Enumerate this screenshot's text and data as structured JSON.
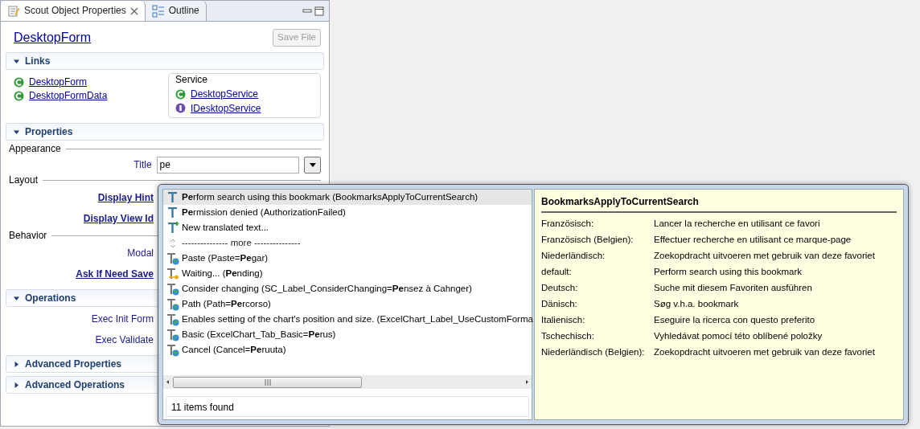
{
  "tabs": [
    {
      "label": "Scout Object Properties",
      "selected": true
    },
    {
      "label": "Outline",
      "selected": false
    }
  ],
  "form": {
    "title": "DesktopForm",
    "save_button": "Save File",
    "save_disabled": true
  },
  "sections": [
    {
      "kind": "links",
      "title": "Links",
      "expanded": true,
      "links": [
        {
          "name": "DesktopForm",
          "kind": "class"
        },
        {
          "name": "DesktopFormData",
          "kind": "class"
        }
      ],
      "service": {
        "title": "Service",
        "links": [
          {
            "name": "DesktopService",
            "kind": "class"
          },
          {
            "name": "IDesktopService",
            "kind": "interface"
          }
        ]
      }
    },
    {
      "kind": "properties",
      "title": "Properties",
      "expanded": true,
      "groups": [
        {
          "title": "Appearance",
          "rows": [
            {
              "label": "Title",
              "link": false,
              "value": "pe"
            }
          ]
        },
        {
          "title": "Layout",
          "rows": [
            {
              "label": "Display Hint",
              "link": true
            },
            {
              "label": "Display View Id",
              "link": true
            }
          ]
        },
        {
          "title": "Behavior",
          "rows": [
            {
              "label": "Modal",
              "link": false
            },
            {
              "label": "Ask If Need Save",
              "link": true
            }
          ]
        }
      ]
    },
    {
      "kind": "operations",
      "title": "Operations",
      "expanded": true,
      "rows": [
        {
          "label": "Exec Init Form",
          "link": false
        },
        {
          "label": "Exec Validate",
          "link": false
        }
      ]
    },
    {
      "title": "Advanced Properties",
      "expanded": false
    },
    {
      "title": "Advanced Operations",
      "expanded": false
    }
  ],
  "popup": {
    "items": [
      {
        "kind": "text",
        "text": "**Pe**rform search using this bookmark (BookmarksApplyToCurrentSearch)",
        "selected": true
      },
      {
        "kind": "text",
        "text": "**Pe**rmission denied (AuthorizationFailed)",
        "selected": false
      },
      {
        "kind": "new",
        "text": "New translated text...",
        "selected": false
      },
      {
        "kind": "more",
        "text": "--------------- more ---------------",
        "selected": false
      },
      {
        "kind": "nls",
        "text": "Paste (Paste=**Pe**gar)",
        "selected": false
      },
      {
        "kind": "pending",
        "text": "Waiting... (**Pe**nding)",
        "selected": false
      },
      {
        "kind": "nls",
        "text": "Consider changing (SC_Label_ConsiderChanging=**Pe**nsez à Cahnger)",
        "selected": false
      },
      {
        "kind": "nls",
        "text": "Path (Path=**Pe**rcorso)",
        "selected": false
      },
      {
        "kind": "nls",
        "text": "Enables setting of the chart's position and size. (ExcelChart_Label_UseCustomForma",
        "selected": false
      },
      {
        "kind": "nls",
        "text": "Basic (ExcelChart_Tab_Basic=**Pe**rus)",
        "selected": false
      },
      {
        "kind": "nls",
        "text": "Cancel (Cancel=**Pe**ruuta)",
        "selected": false
      }
    ],
    "status": "11 items found",
    "detail": {
      "title": "BookmarksApplyToCurrentSearch",
      "entries": [
        {
          "language": "Französisch:",
          "text": "Lancer la recherche en utilisant ce favori"
        },
        {
          "language": "Französisch (Belgien):",
          "text": "Effectuer recherche en utilisant ce marque-page"
        },
        {
          "language": "Niederländisch:",
          "text": "Zoekopdracht uitvoeren met gebruik van deze favoriet"
        },
        {
          "language": "default:",
          "text": "Perform search using this bookmark"
        },
        {
          "language": "Deutsch:",
          "text": "Suche mit diesem Favoriten ausführen"
        },
        {
          "language": "Dänisch:",
          "text": "Søg v.h.a. bookmark"
        },
        {
          "language": "Italienisch:",
          "text": "Eseguire la ricerca con questo preferito"
        },
        {
          "language": "Tschechisch:",
          "text": "Vyhledávat pomocí této oblíbené položky"
        },
        {
          "language": "Niederländisch (Belgien):",
          "text": "Zoekopdracht uitvoeren met gebruik van deze favoriet"
        }
      ]
    }
  }
}
